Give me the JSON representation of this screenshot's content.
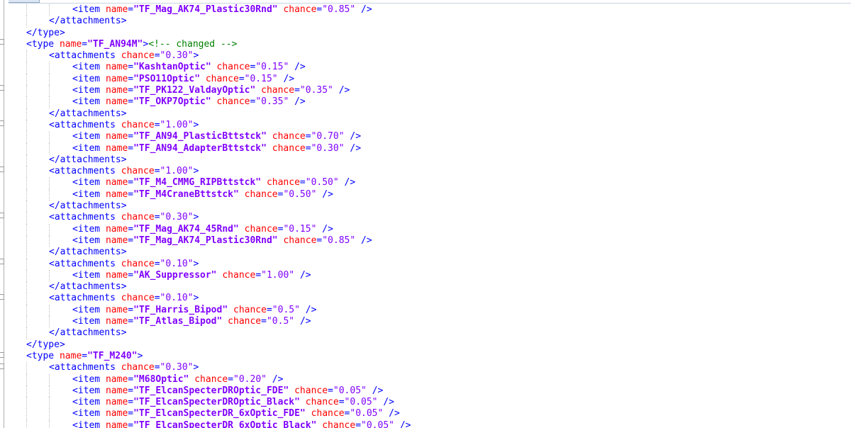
{
  "editor": {
    "lines": [
      {
        "indent": 3,
        "html": "<span class=\"tag\">&lt;item</span> <span class=\"attr\">name</span>=<span class=\"val\">\"TF_Mag_AK74_Plastic30Rnd\"</span> <span class=\"attr\">chance</span>=<span class=\"num\">\"0.85\"</span> <span class=\"tag\">/&gt;</span>"
      },
      {
        "indent": 2,
        "html": "<span class=\"tag\">&lt;/attachments&gt;</span>"
      },
      {
        "indent": 1,
        "html": "<span class=\"tag\">&lt;/type&gt;</span>"
      },
      {
        "indent": 1,
        "html": "<span class=\"tag\">&lt;type</span> <span class=\"attr\">name</span>=<span class=\"val\">\"TF_AN94M\"</span><span class=\"tag\">&gt;</span><span class=\"comment\">&lt;!-- changed --&gt;</span>"
      },
      {
        "indent": 2,
        "html": "<span class=\"tag\">&lt;attachments</span> <span class=\"attr\">chance</span>=<span class=\"num\">\"0.30\"</span><span class=\"tag\">&gt;</span>"
      },
      {
        "indent": 3,
        "html": "<span class=\"tag\">&lt;item</span> <span class=\"attr\">name</span>=<span class=\"val\">\"KashtanOptic\"</span> <span class=\"attr\">chance</span>=<span class=\"num\">\"0.15\"</span> <span class=\"tag\">/&gt;</span>"
      },
      {
        "indent": 3,
        "html": "<span class=\"tag\">&lt;item</span> <span class=\"attr\">name</span>=<span class=\"val\">\"PSO11Optic\"</span> <span class=\"attr\">chance</span>=<span class=\"num\">\"0.15\"</span> <span class=\"tag\">/&gt;</span>"
      },
      {
        "indent": 3,
        "html": "<span class=\"tag\">&lt;item</span> <span class=\"attr\">name</span>=<span class=\"val\">\"TF_PK122_ValdayOptic\"</span> <span class=\"attr\">chance</span>=<span class=\"num\">\"0.35\"</span> <span class=\"tag\">/&gt;</span>"
      },
      {
        "indent": 3,
        "html": "<span class=\"tag\">&lt;item</span> <span class=\"attr\">name</span>=<span class=\"val\">\"TF_OKP7Optic\"</span> <span class=\"attr\">chance</span>=<span class=\"num\">\"0.35\"</span> <span class=\"tag\">/&gt;</span>"
      },
      {
        "indent": 2,
        "html": "<span class=\"tag\">&lt;/attachments&gt;</span>"
      },
      {
        "indent": 2,
        "html": "<span class=\"tag\">&lt;attachments</span> <span class=\"attr\">chance</span>=<span class=\"num\">\"1.00\"</span><span class=\"tag\">&gt;</span>"
      },
      {
        "indent": 3,
        "html": "<span class=\"tag\">&lt;item</span> <span class=\"attr\">name</span>=<span class=\"val\">\"TF_AN94_PlasticBttstck\"</span> <span class=\"attr\">chance</span>=<span class=\"num\">\"0.70\"</span> <span class=\"tag\">/&gt;</span>"
      },
      {
        "indent": 3,
        "html": "<span class=\"tag\">&lt;item</span> <span class=\"attr\">name</span>=<span class=\"val\">\"TF_AN94_AdapterBttstck\"</span> <span class=\"attr\">chance</span>=<span class=\"num\">\"0.30\"</span> <span class=\"tag\">/&gt;</span>"
      },
      {
        "indent": 2,
        "html": "<span class=\"tag\">&lt;/attachments&gt;</span>"
      },
      {
        "indent": 2,
        "html": "<span class=\"tag\">&lt;attachments</span> <span class=\"attr\">chance</span>=<span class=\"num\">\"1.00\"</span><span class=\"tag\">&gt;</span>"
      },
      {
        "indent": 3,
        "html": "<span class=\"tag\">&lt;item</span> <span class=\"attr\">name</span>=<span class=\"val\">\"TF_M4_CMMG_RIPBttstck\"</span> <span class=\"attr\">chance</span>=<span class=\"num\">\"0.50\"</span> <span class=\"tag\">/&gt;</span>"
      },
      {
        "indent": 3,
        "html": "<span class=\"tag\">&lt;item</span> <span class=\"attr\">name</span>=<span class=\"val\">\"TF_M4CraneBttstck\"</span> <span class=\"attr\">chance</span>=<span class=\"num\">\"0.50\"</span> <span class=\"tag\">/&gt;</span>"
      },
      {
        "indent": 2,
        "html": "<span class=\"tag\">&lt;/attachments&gt;</span>"
      },
      {
        "indent": 2,
        "html": "<span class=\"tag\">&lt;attachments</span> <span class=\"attr\">chance</span>=<span class=\"num\">\"0.30\"</span><span class=\"tag\">&gt;</span>"
      },
      {
        "indent": 3,
        "html": "<span class=\"tag\">&lt;item</span> <span class=\"attr\">name</span>=<span class=\"val\">\"TF_Mag_AK74_45Rnd\"</span> <span class=\"attr\">chance</span>=<span class=\"num\">\"0.15\"</span> <span class=\"tag\">/&gt;</span>"
      },
      {
        "indent": 3,
        "html": "<span class=\"tag\">&lt;item</span> <span class=\"attr\">name</span>=<span class=\"val\">\"TF_Mag_AK74_Plastic30Rnd\"</span> <span class=\"attr\">chance</span>=<span class=\"num\">\"0.85\"</span> <span class=\"tag\">/&gt;</span>"
      },
      {
        "indent": 2,
        "html": "<span class=\"tag\">&lt;/attachments&gt;</span>"
      },
      {
        "indent": 2,
        "html": "<span class=\"tag\">&lt;attachments</span> <span class=\"attr\">chance</span>=<span class=\"num\">\"0.10\"</span><span class=\"tag\">&gt;</span>"
      },
      {
        "indent": 3,
        "html": "<span class=\"tag\">&lt;item</span> <span class=\"attr\">name</span>=<span class=\"val\">\"AK_Suppressor\"</span> <span class=\"attr\">chance</span>=<span class=\"num\">\"1.00\"</span> <span class=\"tag\">/&gt;</span>"
      },
      {
        "indent": 2,
        "html": "<span class=\"tag\">&lt;/attachments&gt;</span>"
      },
      {
        "indent": 2,
        "html": "<span class=\"tag\">&lt;attachments</span> <span class=\"attr\">chance</span>=<span class=\"num\">\"0.10\"</span><span class=\"tag\">&gt;</span>"
      },
      {
        "indent": 3,
        "html": "<span class=\"tag\">&lt;item</span> <span class=\"attr\">name</span>=<span class=\"val\">\"TF_Harris_Bipod\"</span> <span class=\"attr\">chance</span>=<span class=\"num\">\"0.5\"</span> <span class=\"tag\">/&gt;</span>"
      },
      {
        "indent": 3,
        "html": "<span class=\"tag\">&lt;item</span> <span class=\"attr\">name</span>=<span class=\"val\">\"TF_Atlas_Bipod\"</span> <span class=\"attr\">chance</span>=<span class=\"num\">\"0.5\"</span> <span class=\"tag\">/&gt;</span>"
      },
      {
        "indent": 2,
        "html": "<span class=\"tag\">&lt;/attachments&gt;</span>"
      },
      {
        "indent": 1,
        "html": "<span class=\"tag\">&lt;/type&gt;</span>"
      },
      {
        "indent": 1,
        "html": "<span class=\"tag\">&lt;type</span> <span class=\"attr\">name</span>=<span class=\"val\">\"TF_M240\"</span><span class=\"tag\">&gt;</span>"
      },
      {
        "indent": 2,
        "html": "<span class=\"tag\">&lt;attachments</span> <span class=\"attr\">chance</span>=<span class=\"num\">\"0.30\"</span><span class=\"tag\">&gt;</span>"
      },
      {
        "indent": 3,
        "html": "<span class=\"tag\">&lt;item</span> <span class=\"attr\">name</span>=<span class=\"val\">\"M68Optic\"</span> <span class=\"attr\">chance</span>=<span class=\"num\">\"0.20\"</span> <span class=\"tag\">/&gt;</span>"
      },
      {
        "indent": 3,
        "html": "<span class=\"tag\">&lt;item</span> <span class=\"attr\">name</span>=<span class=\"val\">\"TF_ElcanSpecterDROptic_FDE\"</span> <span class=\"attr\">chance</span>=<span class=\"num\">\"0.05\"</span> <span class=\"tag\">/&gt;</span>"
      },
      {
        "indent": 3,
        "html": "<span class=\"tag\">&lt;item</span> <span class=\"attr\">name</span>=<span class=\"val\">\"TF_ElcanSpecterDROptic_Black\"</span> <span class=\"attr\">chance</span>=<span class=\"num\">\"0.05\"</span> <span class=\"tag\">/&gt;</span>"
      },
      {
        "indent": 3,
        "html": "<span class=\"tag\">&lt;item</span> <span class=\"attr\">name</span>=<span class=\"val\">\"TF_ElcanSpecterDR_6xOptic_FDE\"</span> <span class=\"attr\">chance</span>=<span class=\"num\">\"0.05\"</span> <span class=\"tag\">/&gt;</span>"
      },
      {
        "indent": 3,
        "html": "<span class=\"tag\">&lt;item</span> <span class=\"attr\">name</span>=<span class=\"val\">\"TF_ElcanSpecterDR_6xOptic_Black\"</span> <span class=\"attr\">chance</span>=<span class=\"num\">\"0.05\"</span> <span class=\"tag\">/&gt;</span>"
      }
    ],
    "colors": {
      "tag": "#0000ff",
      "attribute": "#ff0000",
      "value": "#8000ff",
      "comment": "#008000",
      "background": "#ffffff"
    }
  }
}
